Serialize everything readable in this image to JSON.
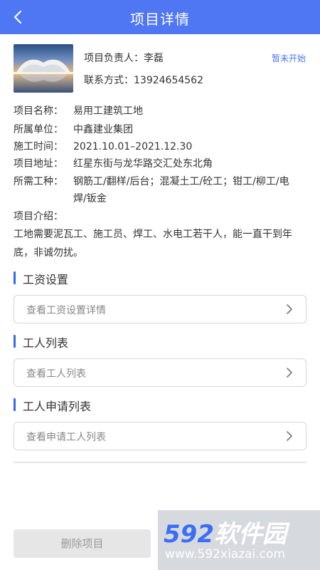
{
  "header": {
    "title": "项目详情"
  },
  "project": {
    "leader": "项目负责人：李磊",
    "contact": "联系方式：13924654562",
    "status": "暂未开始"
  },
  "info": {
    "name_label": "项目名称：",
    "name": "易用工建筑工地",
    "unit_label": "所属单位：",
    "unit": "中鑫建业集团",
    "time_label": "施工时间：",
    "time": "2021.10.01–2021.12.30",
    "address_label": "项目地址：",
    "address": "红星东街与龙华路交汇处东北角",
    "trades_label": "所需工种：",
    "trades": "钢筋工/翻样/后台；混凝土工/砼工；钳工/柳工/电焊/钣金",
    "intro_label": "项目介绍：",
    "intro": "工地需要泥瓦工、施工员、焊工、水电工若干人，能一直干到年底，非诚勿扰。"
  },
  "sections": {
    "salary": {
      "title": "工资设置",
      "link": "查看工资设置详情"
    },
    "workers": {
      "title": "工人列表",
      "link": "查看工人列表"
    },
    "applications": {
      "title": "工人申请列表",
      "link": "查看申请工人列表"
    }
  },
  "actions": {
    "delete_label": "删除项目"
  },
  "watermark": {
    "brand_num": "592",
    "brand_text": "软件园",
    "url": "www.592xiazai.com"
  },
  "icons": {
    "back": "back-arrow-icon",
    "chevron": "chevron-right-icon"
  },
  "colors": {
    "primary": "#4f76f3",
    "section_bar": "#3b65f0",
    "status": "#4f76f3"
  }
}
